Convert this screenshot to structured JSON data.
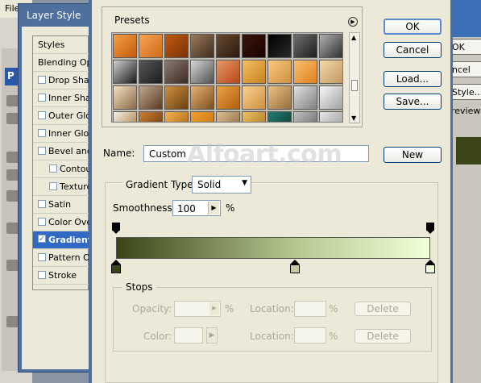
{
  "background_app": {
    "menu_label": "File",
    "tool_badge": "P",
    "right_buttons": [
      "OK",
      "ncel",
      "Style...",
      "review"
    ]
  },
  "layer_style": {
    "title": "Layer Style",
    "items": [
      {
        "label": "Styles",
        "checkbox": false,
        "checked": false,
        "selected": false
      },
      {
        "label": "Blending Options",
        "checkbox": false,
        "checked": false,
        "selected": false
      },
      {
        "label": "Drop Shadow",
        "checkbox": true,
        "checked": false,
        "selected": false
      },
      {
        "label": "Inner Shadow",
        "checkbox": true,
        "checked": false,
        "selected": false
      },
      {
        "label": "Outer Glow",
        "checkbox": true,
        "checked": false,
        "selected": false
      },
      {
        "label": "Inner Glow",
        "checkbox": true,
        "checked": false,
        "selected": false
      },
      {
        "label": "Bevel and Emboss",
        "checkbox": true,
        "checked": false,
        "selected": false
      },
      {
        "label": "Contour",
        "checkbox": true,
        "checked": false,
        "selected": false,
        "indent": true
      },
      {
        "label": "Texture",
        "checkbox": true,
        "checked": false,
        "selected": false,
        "indent": true
      },
      {
        "label": "Satin",
        "checkbox": true,
        "checked": false,
        "selected": false
      },
      {
        "label": "Color Overlay",
        "checkbox": true,
        "checked": false,
        "selected": false
      },
      {
        "label": "Gradient Overlay",
        "checkbox": true,
        "checked": true,
        "selected": true
      },
      {
        "label": "Pattern Overlay",
        "checkbox": true,
        "checked": false,
        "selected": false
      },
      {
        "label": "Stroke",
        "checkbox": true,
        "checked": false,
        "selected": false
      }
    ]
  },
  "gradient_editor": {
    "presets_label": "Presets",
    "buttons": {
      "ok": "OK",
      "cancel": "Cancel",
      "load": "Load...",
      "save": "Save...",
      "new": "New"
    },
    "name_label": "Name:",
    "name_value": "Custom",
    "watermark": "Alfoart.com",
    "gradient_type_label": "Gradient Type:",
    "gradient_type_value": "Solid",
    "smoothness_label": "Smoothness:",
    "smoothness_value": "100",
    "smoothness_unit": "%",
    "stops_label": "Stops",
    "opacity_label": "Opacity:",
    "opacity_unit": "%",
    "location_label": "Location:",
    "location_unit": "%",
    "color_label": "Color:",
    "delete_label": "Delete",
    "gradient_colors": {
      "left": "#3b4416",
      "mid": "#b6c88f",
      "right": "#f1ffd8"
    },
    "color_stops": [
      {
        "location": 0,
        "color": "#3b4416"
      },
      {
        "location": 57,
        "color": "#c5c9a1"
      },
      {
        "location": 100,
        "color": "#f1ffd8"
      }
    ],
    "opacity_stops": [
      {
        "location": 0
      },
      {
        "location": 100
      }
    ],
    "preset_swatches": [
      [
        "#f6a040,#c25a10",
        "#f7a656,#d06a18",
        "#c05a10,#7a3208",
        "#9c7a58,#3c2c20",
        "#6a4a30,#2a1a10",
        "#3a1408,#1a0404",
        "#000000,#2a2a2a",
        "#707070,#1c1c1c",
        "#b0b0b0,#303030"
      ],
      [
        "#d0d0d0,#1a1a1a",
        "#555555,#1e1e1e",
        "#8a7a70,#3a2a24",
        "#d8d8d8,#505050",
        "#e89868,#b84818",
        "#f6c060,#c88020",
        "#f8c880,#d09040",
        "#f8c070,#e08020",
        "#f8d8a8,#c09860"
      ],
      [
        "#f4e0c0,#8a6a4a",
        "#c0a890,#5a3a20",
        "#d09040,#6a4010",
        "#e8b070,#7a5020",
        "#f0a040,#b06010",
        "#f8d090,#d09040",
        "#f0c080,#907040",
        "#e0e0e0,#808080",
        "#f8f8f8,#a0a0a0"
      ],
      [
        "#f8f0e0,#a07040",
        "#d08030,#603010",
        "#f8b050,#a06010",
        "#f0a030,#c07010",
        "#e0c090,#806040",
        "#f0c060,#a07020",
        "#208070,#103030",
        "#c0c0c0,#606060",
        "#e8e8e8,#909090"
      ]
    ]
  }
}
